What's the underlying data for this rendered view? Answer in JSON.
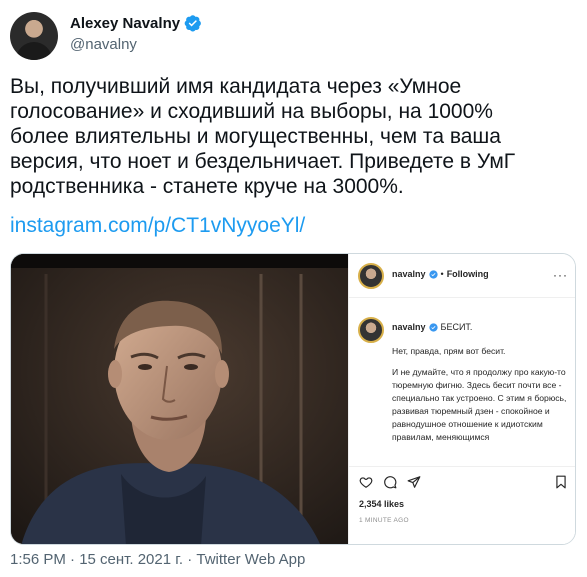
{
  "tweet": {
    "author_name": "Alexey Navalny",
    "handle": "@navalny",
    "text": "Вы, получивший имя кандидата через «Умное\nголосование» и сходивший на выборы, на 1000%\nболее влиятельны и могущественны, чем та ваша\nверсия, что ноет и бездельничает. Приведете в УмГ\nродственника - станете круче на 3000%.",
    "link": "instagram.com/p/CT1vNyyoeYl/",
    "footer": "1:56 PM · 15 сент. 2021 г. · Twitter Web App",
    "verified_color": "#1d9bf0"
  },
  "instagram": {
    "username": "navalny",
    "separator": "•",
    "following": "Following",
    "more": "···",
    "post_title": "БЕСИТ.",
    "p1": "Нет, правда, прям вот бесит.",
    "p2": "И не думайте, что я продолжу про какую-то тюремную фигню. Здесь бесит почти все - специально так устроено. С этим я борюсь, развивая тюремный дзен - спокойное и равнодушное отношение к идиотским правилам, меняющимся",
    "likes": "2,354 likes",
    "time": "1 MINUTE AGO"
  }
}
